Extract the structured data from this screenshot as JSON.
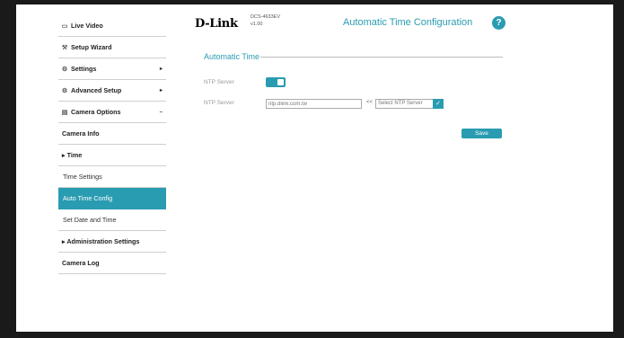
{
  "sidebar": {
    "items": [
      {
        "label": "Live Video",
        "icon": "video-icon"
      },
      {
        "label": "Setup Wizard",
        "icon": "wand-icon"
      },
      {
        "label": "Settings",
        "icon": "gear-icon",
        "arrow": "▸"
      },
      {
        "label": "Advanced Setup",
        "icon": "gears-icon",
        "arrow": "▸"
      },
      {
        "label": "Camera Options",
        "icon": "document-icon",
        "arrow": "–"
      },
      {
        "label": "Camera Info"
      },
      {
        "label": "▸ Time"
      },
      {
        "label": "Time Settings"
      },
      {
        "label": "Auto Time Config"
      },
      {
        "label": "Set Date and Time"
      },
      {
        "label": "▸ Administration Settings"
      },
      {
        "label": "Camera Log"
      }
    ]
  },
  "header": {
    "logo": "D-Link",
    "model": "DCS-4633EV",
    "version": "v1.00",
    "title": "Automatic Time Configuration",
    "help_glyph": "?"
  },
  "section": {
    "title": "Automatic Time",
    "ntp_toggle_label": "NTP Server",
    "ntp_server_label": "NTP Server",
    "ntp_server_value": "ntp.dlink.com.tw",
    "arrow_text": "<<",
    "select_value": "Select NTP Server",
    "save_label": "Save"
  },
  "colors": {
    "accent": "#2a9cb1"
  }
}
